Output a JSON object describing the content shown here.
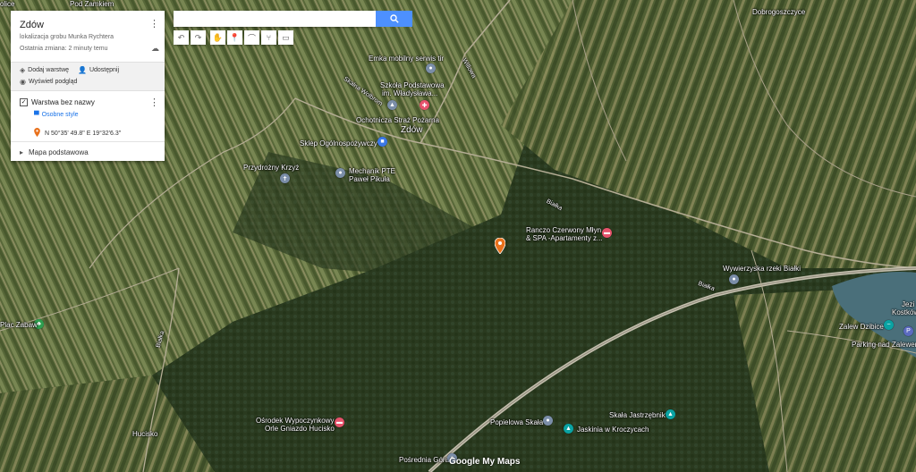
{
  "panel": {
    "title": "Zdów",
    "description": "lokalizacja grobu Munka Rychtera",
    "last_edit": "Ostatnia zmiana: 2 minuty temu",
    "add_layer": "Dodaj warstwę",
    "share": "Udostępnij",
    "preview": "Wyświetl podgląd",
    "layer_name": "Warstwa bez nazwy",
    "style_link": "Osobne style",
    "marker_coords": "N 50°35' 49.8\" E 19°32'6.3\"",
    "base_map": "Mapa podstawowa"
  },
  "search": {
    "placeholder": ""
  },
  "toolbar": {
    "tools": [
      "undo-icon",
      "redo-icon",
      "hand-icon",
      "marker-icon",
      "polygon-icon",
      "route-icon",
      "ruler-icon"
    ]
  },
  "map": {
    "labels": {
      "pod_zamkiem": "Pod Zamkiem",
      "olice": "olice",
      "dobrogoszczyce": "Dobrogoszczyce",
      "emka": "Emka mobilny serwis tir",
      "szkola1": "Szkoła Podstawowa",
      "szkola2": "im. Władysława...",
      "osp": "Ochotnicza Straż Pożarna",
      "zdow": "Zdów",
      "sklep": "Sklep Ogólnospożywczy",
      "krzyz": "Przydrożny Krzyż",
      "mechanik1": "Mechanik PTE",
      "mechanik2": "Paweł Pikuła",
      "ranczo1": "Ranczo Czerwony Młyn",
      "ranczo2": "& SPA -Apartamenty z...",
      "wywierzyska": "Wywierzyska rzeki Białki",
      "zalew": "Zalew Dzibice",
      "parking": "Parking nad Zalewem",
      "jezio1": "Jezi",
      "jezio2": "Kostków",
      "plac": "Plac Zabaw",
      "osrodek1": "Ośrodek Wypoczynkowy",
      "osrodek2": "Orle Gniazdo Hucisko",
      "popielowa": "Popielowa Skała",
      "jastrzebnik": "Skała Jastrzębnik",
      "jaskinia": "Jaskinia w Kroczycach",
      "posrednia": "Pośrednia Góra",
      "hucisko": "Hucisko",
      "bialka1": "Białka",
      "bialka2": "Białka",
      "bialka3": "Białka",
      "wolbrom": "Skalna Wolbrom",
      "willowa": "Willowa"
    },
    "logo": "Google My Maps"
  },
  "colors": {
    "accent": "#4d90fe",
    "marker": "#e8711c",
    "link": "#1a73e8"
  }
}
